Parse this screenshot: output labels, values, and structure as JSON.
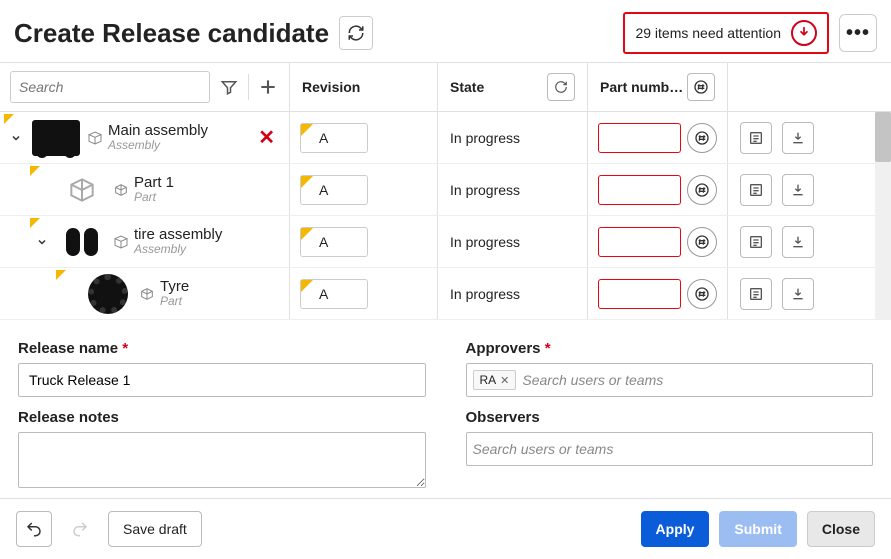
{
  "header": {
    "title": "Create Release candidate",
    "attention_text": "29 items need attention"
  },
  "toolbar": {
    "search_placeholder": "Search"
  },
  "columns": {
    "revision": "Revision",
    "state": "State",
    "part": "Part numb…"
  },
  "rows": [
    {
      "name": "Main assembly",
      "sub": "Assembly",
      "indent": 0,
      "expander": true,
      "closable": true,
      "revision": "A",
      "state": "In progress",
      "thumb": "chassis"
    },
    {
      "name": "Part 1",
      "sub": "Part",
      "indent": 1,
      "expander": false,
      "closable": false,
      "revision": "A",
      "state": "In progress",
      "thumb": "part"
    },
    {
      "name": "tire assembly",
      "sub": "Assembly",
      "indent": 1,
      "expander": true,
      "closable": false,
      "revision": "A",
      "state": "In progress",
      "thumb": "tirepair"
    },
    {
      "name": "Tyre",
      "sub": "Part",
      "indent": 2,
      "expander": false,
      "closable": false,
      "revision": "A",
      "state": "In progress",
      "thumb": "tire"
    }
  ],
  "form": {
    "release_name_label": "Release name",
    "release_name_value": "Truck Release 1",
    "release_notes_label": "Release notes",
    "approvers_label": "Approvers",
    "approvers_chip": "RA",
    "approvers_placeholder": "Search users or teams",
    "observers_label": "Observers",
    "observers_placeholder": "Search users or teams"
  },
  "footer": {
    "save_draft": "Save draft",
    "apply": "Apply",
    "submit": "Submit",
    "close": "Close"
  }
}
